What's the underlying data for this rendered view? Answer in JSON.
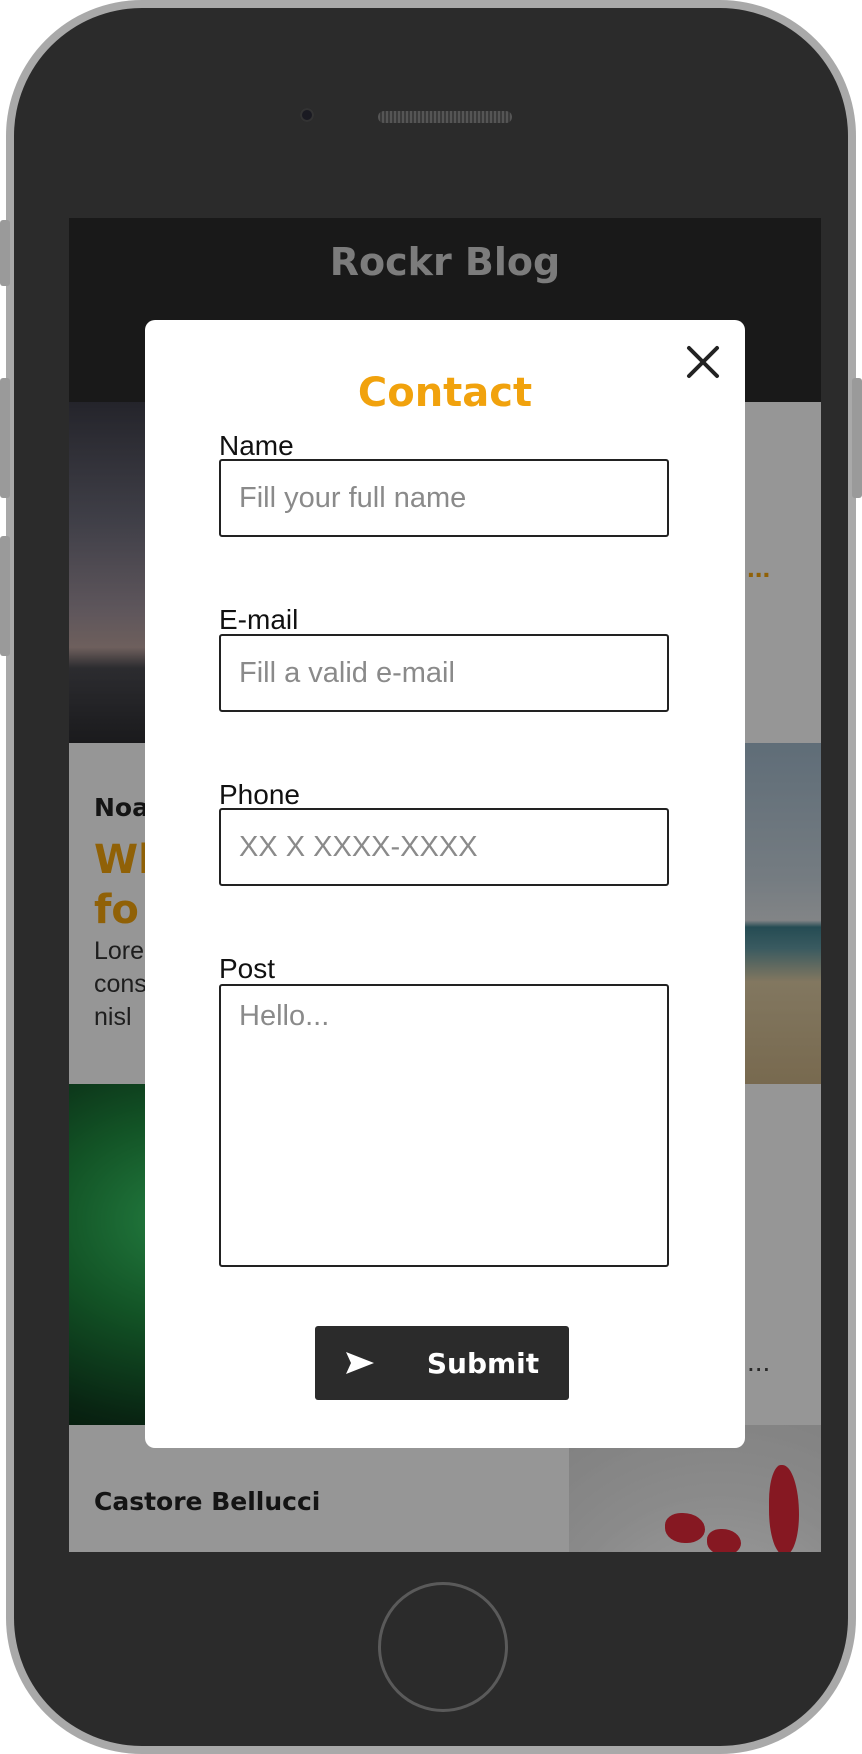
{
  "blog": {
    "title": "Rockr Blog"
  },
  "posts": [
    {
      "author": "Noa",
      "title_line1": "Wh",
      "title_line2": "fo",
      "excerpt_line1": "Lore",
      "excerpt_line2": "cons",
      "excerpt_line3": "nisl"
    },
    {
      "author": "Castore Bellucci"
    }
  ],
  "ellipsis": {
    "orange": "...",
    "gray": "..."
  },
  "modal": {
    "title": "Contact",
    "fields": {
      "name": {
        "label": "Name",
        "placeholder": "Fill your full name"
      },
      "email": {
        "label": "E-mail",
        "placeholder": "Fill a valid e-mail"
      },
      "phone": {
        "label": "Phone",
        "placeholder": "XX X XXXX-XXXX"
      },
      "post": {
        "label": "Post",
        "placeholder": "Hello..."
      }
    },
    "submit_label": "Submit",
    "close_icon": "close-icon",
    "submit_icon": "send-icon"
  },
  "colors": {
    "accent": "#f1a20d",
    "dark": "#2b2b2b",
    "overlay": "rgba(0,0,0,0.4)"
  }
}
